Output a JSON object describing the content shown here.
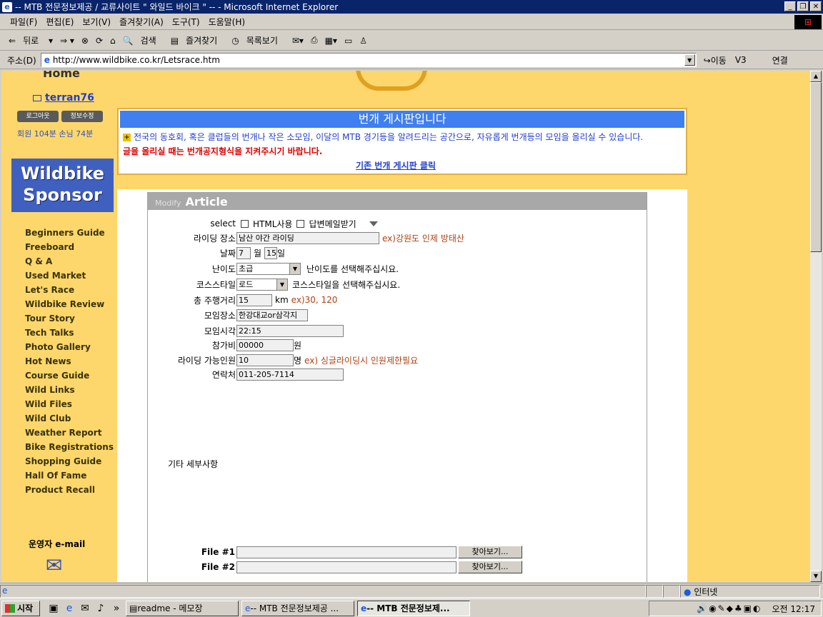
{
  "window": {
    "title": "-- MTB 전문정보제공 / 교류사이트 \" 와일드 바이크 \" -- - Microsoft Internet Explorer"
  },
  "menu": [
    "파일(F)",
    "편집(E)",
    "보기(V)",
    "즐겨찾기(A)",
    "도구(T)",
    "도움말(H)"
  ],
  "toolbar": {
    "back": "뒤로",
    "search": "검색",
    "favorites": "즐겨찾기",
    "history": "목록보기"
  },
  "address": {
    "label": "주소(D)",
    "url": "http://www.wildbike.co.kr/Letsrace.htm",
    "go": "이동",
    "v3": "V3",
    "links": "연결"
  },
  "sidebar": {
    "home": "Home",
    "user": "terran76",
    "logout": "로그아웃",
    "edit_info": "정보수정",
    "members": "회원 104분  손님 74분",
    "sponsor_line1": "Wildbike",
    "sponsor_line2": "Sponsor",
    "nav": [
      "Beginners Guide",
      "Freeboard",
      "Q & A",
      "Used Market",
      "Let's Race",
      "Wildbike Review",
      "Tour Story",
      "Tech Talks",
      "Photo Gallery",
      "Hot News",
      "Course Guide",
      "Wild Links",
      "Wild Files",
      "Wild Club",
      "Weather Report",
      "Bike Registrations",
      "Shopping Guide",
      "Hall Of Fame",
      "Product Recall"
    ],
    "admin_email": "운영자 e-mail"
  },
  "board": {
    "title": "번개 게시판입니다",
    "desc": "전국의 동호회, 혹은 클럽들의 번개나 작은 소모임, 이달의 MTB 경기등을 알려드리는 공간으로, 자유롭게 번개등의 모임을 올리실 수 있습니다.",
    "warning": "글을 올리실 때는 번개공지형식을 지켜주시기 바랍니다.",
    "link": "기존 번개 게시판 클릭"
  },
  "form": {
    "header_small": "Modify",
    "header_big": "Article",
    "select_label": "select",
    "html_use": "HTML사용",
    "reply_mail": "답변메일받기",
    "place_label": "라이딩 장소",
    "place_value": "남산 야간 라이딩",
    "place_ex": "ex)강원도 인제 방태산",
    "date_label": "날짜",
    "month": "7",
    "month_unit": "월",
    "day": "15",
    "day_unit": "일",
    "level_label": "난이도",
    "level_value": "초급",
    "level_hint": "난이도를 선택해주십시요.",
    "course_label": "코스스타일",
    "course_value": "로드",
    "course_hint": "코스스타일을 선택해주십시요.",
    "distance_label": "총 주행거리",
    "distance_value": "15",
    "distance_unit": "km",
    "distance_ex": "ex)30, 120",
    "meet_place_label": "모임장소",
    "meet_place_value": "한강대교or삼각지",
    "meet_time_label": "모임시각",
    "meet_time_value": "22:15",
    "fee_label": "참가비",
    "fee_value": "00000",
    "fee_unit": "원",
    "capacity_label": "라이딩 가능인원",
    "capacity_value": "10",
    "capacity_unit": "명",
    "capacity_ex": "ex) 싱글라이딩시 인원제한필요",
    "contact_label": "연락처",
    "contact_value": "011-205-7114",
    "etc_label": "기타 세부사항",
    "file1_label": "File #1",
    "file2_label": "File #2",
    "browse": "찾아보기..."
  },
  "status": {
    "zone": "인터넷"
  },
  "taskbar": {
    "start": "시작",
    "tasks": [
      "readme - 메모장",
      "-- MTB 전문정보제공 ...",
      "-- MTB 전문정보제..."
    ],
    "clock": "오전 12:17"
  }
}
